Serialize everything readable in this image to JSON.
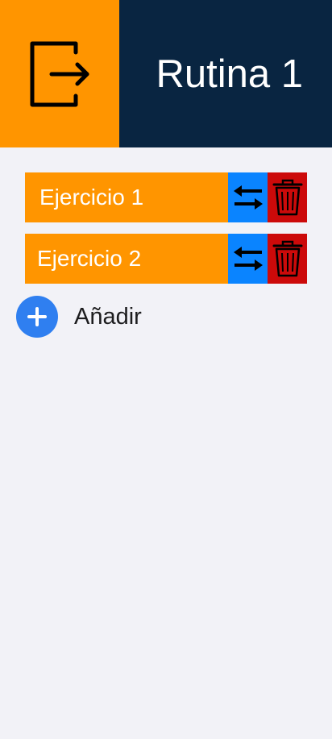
{
  "header": {
    "title": "Rutina 1",
    "exit_icon": "logout-icon",
    "colors": {
      "exit_bg": "#ff9500",
      "title_bg": "#092541"
    }
  },
  "exercises": [
    {
      "name": "Ejercicio 1",
      "reorder_icon": "swap-arrows-icon",
      "delete_icon": "trash-icon"
    },
    {
      "name": "Ejercicio 2",
      "reorder_icon": "swap-arrows-icon",
      "delete_icon": "trash-icon"
    }
  ],
  "add": {
    "label": "Añadir",
    "icon": "plus-circle-icon"
  },
  "colors": {
    "exercise_bg": "#ff9500",
    "reorder_bg": "#0a84ff",
    "delete_bg": "#cc0a0a",
    "add_bg": "#2f7ff0",
    "page_bg": "#f2f2f7"
  }
}
